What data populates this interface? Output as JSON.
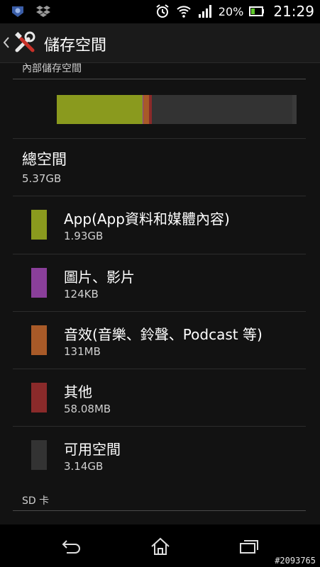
{
  "status": {
    "battery_pct": "20%",
    "time": "21:29"
  },
  "header": {
    "title": "儲存空間"
  },
  "internal": {
    "section_title": "內部儲存空間",
    "total_label": "總空間",
    "total_value": "5.37GB",
    "usage_fractions": [
      0.359,
      0.003,
      0.024,
      0.011,
      0.584
    ],
    "items": [
      {
        "label": "App(App資料和媒體內容)",
        "value": "1.93GB",
        "color": "#8a9a1e"
      },
      {
        "label": "圖片、影片",
        "value": "124KB",
        "color": "#8a3f9a"
      },
      {
        "label": "音效(音樂、鈴聲、Podcast 等)",
        "value": "131MB",
        "color": "#a85a28"
      },
      {
        "label": "其他",
        "value": "58.08MB",
        "color": "#8a2a2a"
      },
      {
        "label": "可用空間",
        "value": "3.14GB",
        "color": "#333333"
      }
    ]
  },
  "sd": {
    "section_title": "SD 卡"
  },
  "watermark": "#2093765"
}
